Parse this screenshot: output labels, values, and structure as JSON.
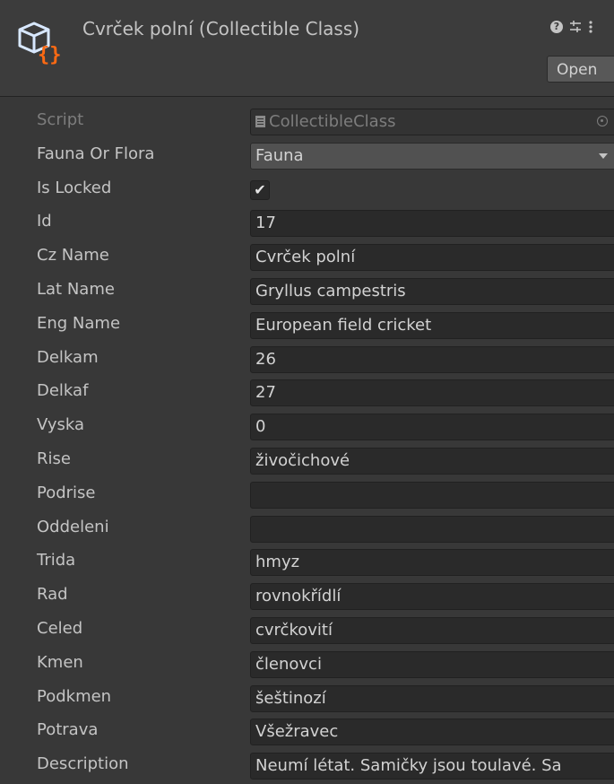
{
  "header": {
    "title": "Cvrček polní (Collectible Class)",
    "open_label": "Open",
    "help_glyph": "?",
    "icons": [
      "scriptable-object-icon",
      "help-icon",
      "settings-icon",
      "more-icon"
    ]
  },
  "fields": {
    "script": {
      "label": "Script",
      "value": "CollectibleClass"
    },
    "fauna_or_flora": {
      "label": "Fauna Or Flora",
      "value": "Fauna"
    },
    "is_locked": {
      "label": "Is Locked",
      "check": "✔"
    },
    "id": {
      "label": "Id",
      "value": "17"
    },
    "cz_name": {
      "label": "Cz Name",
      "value": "Cvrček polní"
    },
    "lat_name": {
      "label": "Lat Name",
      "value": "Gryllus campestris"
    },
    "eng_name": {
      "label": "Eng Name",
      "value": "European field cricket"
    },
    "delkam": {
      "label": "Delkam",
      "value": "26"
    },
    "delkaf": {
      "label": "Delkaf",
      "value": "27"
    },
    "vyska": {
      "label": "Vyska",
      "value": "0"
    },
    "rise": {
      "label": "Rise",
      "value": "živočichové"
    },
    "podrise": {
      "label": "Podrise",
      "value": ""
    },
    "oddeleni": {
      "label": "Oddeleni",
      "value": ""
    },
    "trida": {
      "label": "Trida",
      "value": "hmyz"
    },
    "rad": {
      "label": "Rad",
      "value": "rovnokřídlí"
    },
    "celed": {
      "label": "Celed",
      "value": "cvrčkovití"
    },
    "kmen": {
      "label": "Kmen",
      "value": "členovci"
    },
    "podkmen": {
      "label": "Podkmen",
      "value": "šeštinozí"
    },
    "potrava": {
      "label": "Potrava",
      "value": "Všežravec"
    },
    "description": {
      "label": "Description",
      "value": "Neumí létat. Samičky jsou toulavé. Sa"
    }
  },
  "colors": {
    "background": "#383838",
    "field": "#2a2a2a",
    "icon_orange": "#ff6a13",
    "icon_blue": "#d8e8ff"
  }
}
